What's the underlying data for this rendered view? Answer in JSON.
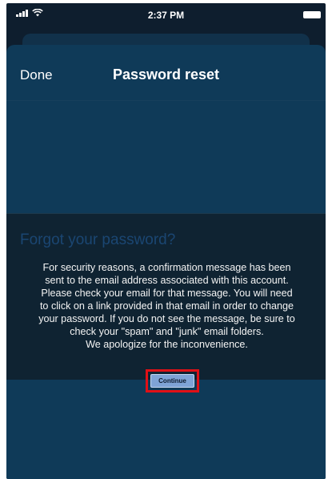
{
  "status_bar": {
    "time": "2:37 PM",
    "signal_icon": "cellular-signal-icon",
    "wifi_icon": "wifi-icon",
    "battery_icon": "battery-icon"
  },
  "nav": {
    "done_label": "Done",
    "title": "Password reset"
  },
  "content": {
    "heading": "Forgot your password?"
  },
  "dialog": {
    "lines": [
      "For security reasons, a confirmation message has been",
      "sent to the email address associated with this account.",
      "Please check your email for that message. You will need",
      "to click on a link provided in that email in order to change",
      "your password. If you do not see the message, be sure to",
      "check your \"spam\" and \"junk\" email folders.",
      "We apologize for the inconvenience."
    ],
    "button_label": "Continue",
    "highlight_color": "#e01016"
  }
}
